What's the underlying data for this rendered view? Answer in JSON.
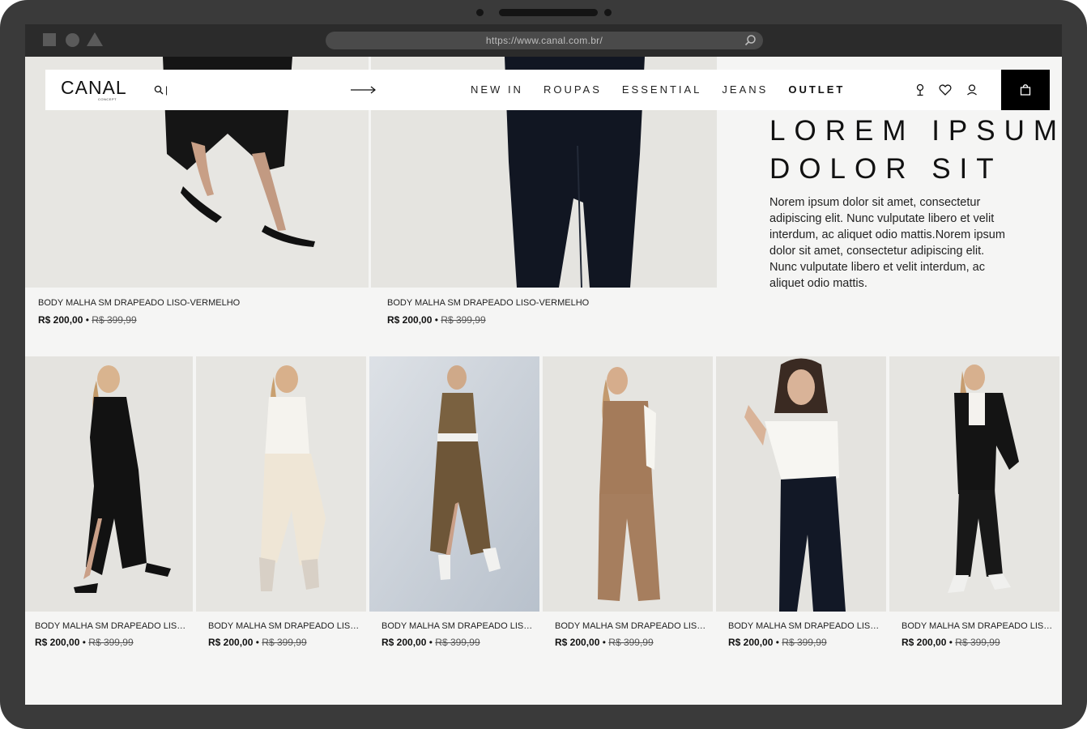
{
  "browser": {
    "url": "https://www.canal.com.br/"
  },
  "header": {
    "logo": "CANAL",
    "logo_sub": "CONCEPT",
    "search_value": "|",
    "nav": [
      "NEW IN",
      "ROUPAS",
      "ESSENTIAL",
      "JEANS",
      "OUTLET"
    ]
  },
  "hero": {
    "title_line1": "LOREM IPSUM",
    "title_line2": "DOLOR SIT",
    "text": "Norem ipsum dolor sit amet, consectetur adipiscing elit. Nunc vulputate libero et velit interdum, ac aliquet odio mattis.Norem ipsum dolor sit amet, consectetur adipiscing elit. Nunc vulputate libero et velit interdum, ac aliquet odio mattis."
  },
  "featured_products": [
    {
      "name": "BODY MALHA SM DRAPEADO LISO-VERMELHO",
      "price": "R$ 200,00",
      "old_price": "R$ 399,99"
    },
    {
      "name": "BODY MALHA SM DRAPEADO LISO-VERMELHO",
      "price": "R$ 200,00",
      "old_price": "R$ 399,99"
    }
  ],
  "products": [
    {
      "name": "BODY MALHA SM DRAPEADO LISO-VERMELHO",
      "price": "R$ 200,00",
      "old_price": "R$ 399,99"
    },
    {
      "name": "BODY MALHA SM DRAPEADO LISO-VERMELHO",
      "price": "R$ 200,00",
      "old_price": "R$ 399,99"
    },
    {
      "name": "BODY MALHA SM DRAPEADO LISO-VERMELHO",
      "price": "R$ 200,00",
      "old_price": "R$ 399,99"
    },
    {
      "name": "BODY MALHA SM DRAPEADO LISO-VERMELHO",
      "price": "R$ 200,00",
      "old_price": "R$ 399,99"
    },
    {
      "name": "BODY MALHA SM DRAPEADO LISO-VERMELHO",
      "price": "R$ 200,00",
      "old_price": "R$ 399,99"
    },
    {
      "name": "BODY MALHA SM DRAPEADO LISO-VERMELHO",
      "price": "R$ 200,00",
      "old_price": "R$ 399,99"
    }
  ],
  "price_separator": "•",
  "icons": [
    "search-icon",
    "arrow-right-icon",
    "location-pin-icon",
    "heart-icon",
    "user-icon",
    "shopping-bag-icon"
  ],
  "colors": {
    "frame": "#3a3a3a",
    "page_bg": "#f5f5f4",
    "cart_bg": "#000000"
  }
}
